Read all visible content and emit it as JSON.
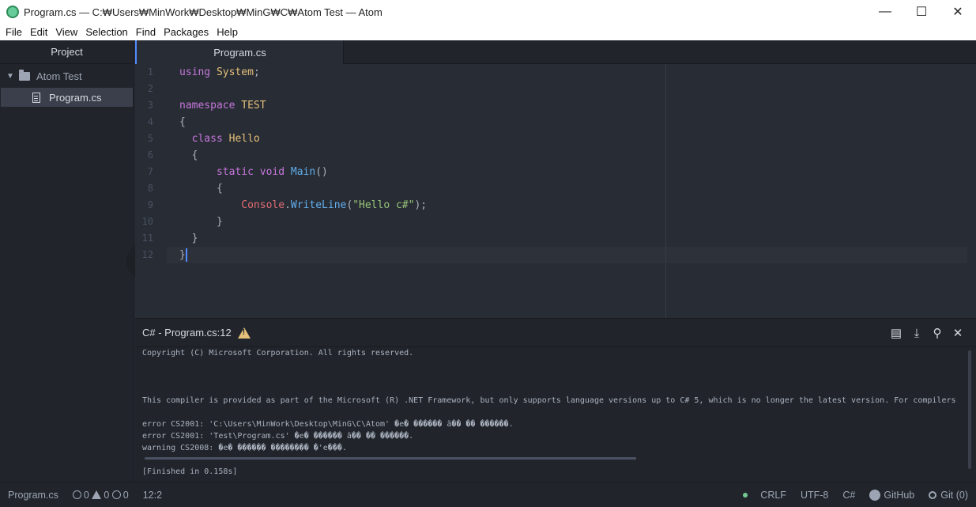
{
  "window": {
    "title": "Program.cs — C:₩Users₩MinWork₩Desktop₩MinG₩C₩Atom Test — Atom",
    "minimize": "—",
    "maximize": "☐",
    "close": "✕"
  },
  "menu": [
    "File",
    "Edit",
    "View",
    "Selection",
    "Find",
    "Packages",
    "Help"
  ],
  "tree": {
    "header": "Project",
    "root": "Atom Test",
    "files": [
      "Program.cs"
    ]
  },
  "tab": {
    "label": "Program.cs"
  },
  "editor": {
    "line_numbers": [
      "1",
      "2",
      "3",
      "4",
      "5",
      "6",
      "7",
      "8",
      "9",
      "10",
      "11",
      "12"
    ],
    "lines": [
      [
        {
          "t": "using ",
          "c": "kw"
        },
        {
          "t": "System",
          "c": "ty"
        },
        {
          "t": ";",
          "c": ""
        }
      ],
      [],
      [
        {
          "t": "namespace ",
          "c": "kw"
        },
        {
          "t": "TEST",
          "c": "ty"
        }
      ],
      [
        {
          "t": "{",
          "c": ""
        }
      ],
      [
        {
          "t": "  ",
          "c": ""
        },
        {
          "t": "class ",
          "c": "kw"
        },
        {
          "t": "Hello",
          "c": "ty"
        }
      ],
      [
        {
          "t": "  {",
          "c": ""
        }
      ],
      [
        {
          "t": "      ",
          "c": ""
        },
        {
          "t": "static ",
          "c": "kw"
        },
        {
          "t": "void ",
          "c": "kw"
        },
        {
          "t": "Main",
          "c": "fn"
        },
        {
          "t": "()",
          "c": ""
        }
      ],
      [
        {
          "t": "      {",
          "c": ""
        }
      ],
      [
        {
          "t": "          ",
          "c": ""
        },
        {
          "t": "Console",
          "c": "rd"
        },
        {
          "t": ".",
          "c": ""
        },
        {
          "t": "WriteLine",
          "c": "fn"
        },
        {
          "t": "(",
          "c": ""
        },
        {
          "t": "\"Hello c#\"",
          "c": "st"
        },
        {
          "t": ");",
          "c": ""
        }
      ],
      [
        {
          "t": "      }",
          "c": ""
        }
      ],
      [
        {
          "t": "  }",
          "c": ""
        }
      ],
      [
        {
          "t": "}",
          "c": ""
        }
      ]
    ]
  },
  "panel": {
    "title": "C# - Program.cs:12",
    "output": [
      "Copyright (C) Microsoft Corporation. All rights reserved.",
      "",
      "",
      "",
      "This compiler is provided as part of the Microsoft (R) .NET Framework, but only supports language versions up to C# 5, which is no longer the latest version. For compilers",
      "",
      "error CS2001: 'C:\\Users\\MinWork\\Desktop\\MinG\\C\\Atom' �e� ������ ã�� �� ������.",
      "error CS2001: 'Test\\Program.cs' �e� ������ ã�� �� ������.",
      "warning CS2008: �e� ������ �������� �'e���.",
      "",
      "[Finished in 0.158s]"
    ]
  },
  "status": {
    "file": "Program.cs",
    "errors": "0",
    "warnings": "0",
    "infos": "0",
    "cursor": "12:2",
    "line_ending": "CRLF",
    "encoding": "UTF-8",
    "grammar": "C#",
    "github": "GitHub",
    "git": "Git (0)"
  }
}
